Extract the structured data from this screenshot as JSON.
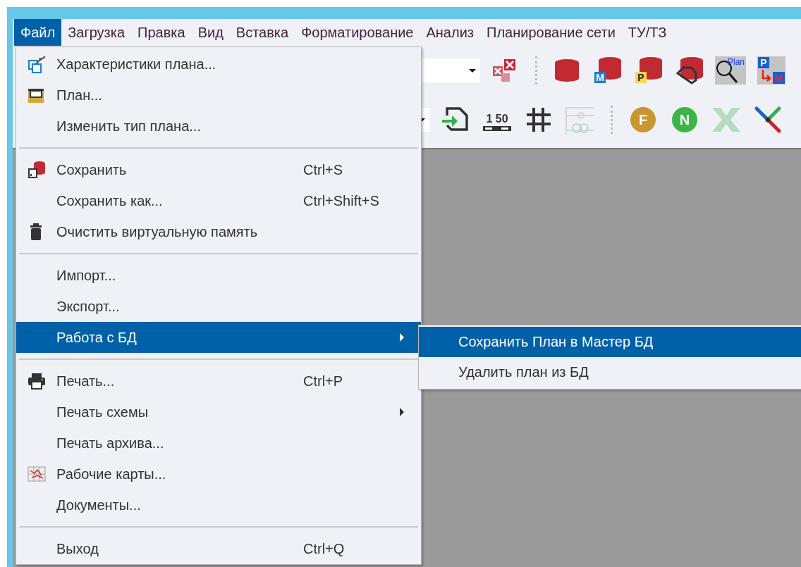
{
  "menubar": [
    {
      "label": "Файл",
      "selected": true
    },
    {
      "label": "Загрузка",
      "selected": false
    },
    {
      "label": "Правка",
      "selected": false
    },
    {
      "label": "Вид",
      "selected": false
    },
    {
      "label": "Вставка",
      "selected": false
    },
    {
      "label": "Форматирование",
      "selected": false
    },
    {
      "label": "Анализ",
      "selected": false
    },
    {
      "label": "Планирование сети",
      "selected": false
    },
    {
      "label": "ТУ/ТЗ",
      "selected": false
    }
  ],
  "toolbar": {
    "row_1": [
      {
        "kind": "combo"
      },
      {
        "kind": "delete-cross"
      },
      {
        "kind": "separator"
      },
      {
        "kind": "db"
      },
      {
        "kind": "db-badge",
        "label": "M",
        "color": "#1a7fd0"
      },
      {
        "kind": "db-badge",
        "label": "P",
        "color": "#f5d84a"
      },
      {
        "kind": "db-shape"
      },
      {
        "kind": "plan-search",
        "label": "Plan"
      },
      {
        "kind": "plan-transfer",
        "label": "P",
        "label_2": "M"
      }
    ],
    "row_2": [
      {
        "kind": "combo"
      },
      {
        "kind": "import"
      },
      {
        "kind": "scale",
        "label": "1 50"
      },
      {
        "kind": "grid"
      },
      {
        "kind": "filter",
        "disabled": true
      },
      {
        "kind": "separator"
      },
      {
        "kind": "circle",
        "label": "F",
        "color": "#c8962e"
      },
      {
        "kind": "circle",
        "label": "N",
        "color": "#3bb54a"
      },
      {
        "kind": "excel",
        "disabled": true
      },
      {
        "kind": "cross"
      }
    ]
  },
  "file_menu": {
    "items": [
      {
        "kind": "properties",
        "label": "Характеристики плана...",
        "selected": false,
        "submenu": false
      },
      {
        "kind": "folder",
        "label": "План...",
        "selected": false,
        "submenu": false
      },
      {
        "kind": "plain",
        "label": "Изменить тип плана...",
        "selected": false,
        "submenu": false
      },
      {
        "kind": "separator"
      },
      {
        "kind": "save",
        "label": "Сохранить",
        "shortcut": "Ctrl+S",
        "selected": false,
        "submenu": false
      },
      {
        "kind": "plain",
        "label": "Сохранить как...",
        "shortcut": "Ctrl+Shift+S",
        "selected": false,
        "submenu": false
      },
      {
        "kind": "trash",
        "label": "Очистить виртуальную память",
        "selected": false,
        "submenu": false
      },
      {
        "kind": "separator"
      },
      {
        "kind": "plain",
        "label": "Импорт...",
        "selected": false,
        "submenu": false
      },
      {
        "kind": "plain",
        "label": "Экспорт...",
        "selected": false,
        "submenu": false
      },
      {
        "kind": "plain",
        "label": "Работа с БД",
        "selected": true,
        "submenu": true
      },
      {
        "kind": "separator"
      },
      {
        "kind": "print",
        "label": "Печать...",
        "shortcut": "Ctrl+P",
        "selected": false,
        "submenu": false
      },
      {
        "kind": "plain",
        "label": "Печать схемы",
        "selected": false,
        "submenu": true
      },
      {
        "kind": "plain",
        "label": "Печать архива...",
        "selected": false,
        "submenu": false
      },
      {
        "kind": "map",
        "label": "Рабочие карты...",
        "selected": false,
        "submenu": false
      },
      {
        "kind": "plain",
        "label": "Документы...",
        "selected": false,
        "submenu": false
      },
      {
        "kind": "separator"
      },
      {
        "kind": "plain",
        "label": "Выход",
        "shortcut": "Ctrl+Q",
        "selected": false,
        "submenu": false
      }
    ]
  },
  "db_submenu": {
    "items": [
      {
        "label": "Сохранить План в Мастер БД",
        "selected": true
      },
      {
        "label": "Удалить план из БД",
        "selected": false
      }
    ]
  }
}
